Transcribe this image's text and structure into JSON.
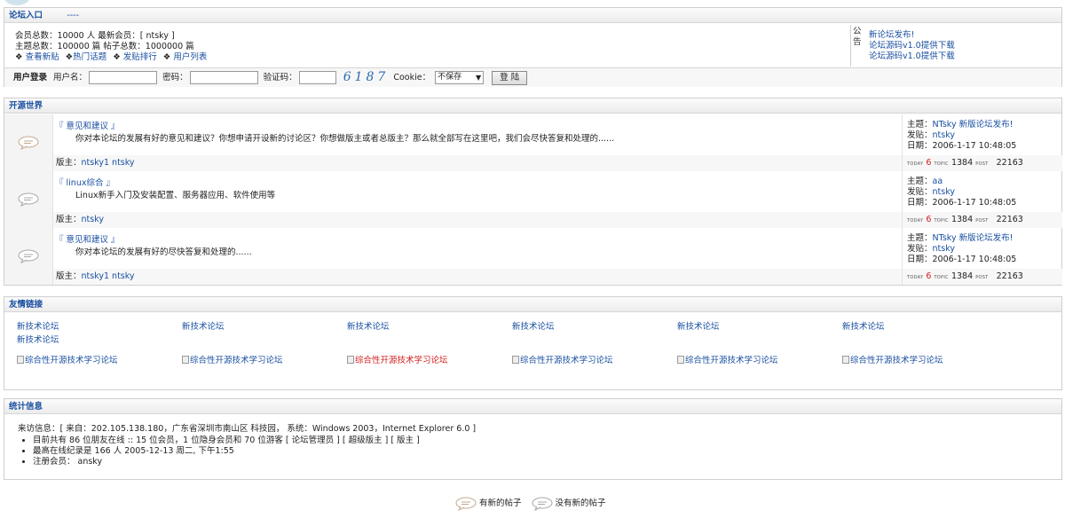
{
  "entry": {
    "title": "论坛入口",
    "dash": "----",
    "stats_line1": "会员总数：10000 人  最新会员：[ ntsky ]",
    "stats_line2": "主题总数：100000 篇  帖子总数：1000000 篇",
    "quick_links": [
      "查看新贴",
      "热门话题",
      "发贴排行",
      "用户列表"
    ],
    "notice_label": "公告",
    "notices": [
      "新论坛发布!",
      "论坛源码v1.0提供下载",
      "论坛源码v1.0提供下载"
    ]
  },
  "login": {
    "title": "用户登录",
    "username_label": "用户名：",
    "password_label": "密码：",
    "captcha_label": "验证码：",
    "captcha_code": "6187",
    "cookie_label": "Cookie：",
    "cookie_value": "不保存",
    "submit": "登 陆"
  },
  "forums": {
    "title": "开源世界",
    "items": [
      {
        "name": "『 意见和建议 』",
        "desc": "你对本论坛的发展有好的意见和建议？你想申请开设新的讨论区？你想做版主或者总版主？那么就全部写在这里吧，我们会尽快答复和处理的......",
        "mod_label": "版主：",
        "mods": "ntsky1 ntsky",
        "topic_label": "主题：",
        "topic": "NTsky 新版论坛发布!",
        "author_label": "发贴：",
        "author": "ntsky",
        "date": "日期：2006-1-17 10:48:05",
        "today_tag": "TODAY",
        "today": "6",
        "topic_tag": "TOPIC",
        "topics": "1384",
        "post_tag": "POST",
        "posts": "22163"
      },
      {
        "name": "『 linux综合 』",
        "desc": "Linux新手入门及安装配置、服务器应用、软件使用等",
        "mod_label": "版主：",
        "mods": "ntsky",
        "topic_label": "主题：",
        "topic": "aa",
        "author_label": "发贴：",
        "author": "ntsky",
        "date": "日期：2006-1-17 10:48:05",
        "today_tag": "TODAY",
        "today": "6",
        "topic_tag": "TOPIC",
        "topics": "1384",
        "post_tag": "POST",
        "posts": "22163"
      },
      {
        "name": "『 意见和建议 』",
        "desc": "你对本论坛的发展有好的尽快答复和处理的......",
        "mod_label": "版主：",
        "mods": "ntsky1 ntsky",
        "topic_label": "主题：",
        "topic": "NTsky 新版论坛发布!",
        "author_label": "发贴：",
        "author": "ntsky",
        "date": "日期：2006-1-17 10:48:05",
        "today_tag": "TODAY",
        "today": "6",
        "topic_tag": "TOPIC",
        "topics": "1384",
        "post_tag": "POST",
        "posts": "22163"
      }
    ]
  },
  "friend_links": {
    "title": "友情链接",
    "text_links": [
      "新技术论坛",
      "新技术论坛",
      "新技术论坛",
      "新技术论坛",
      "新技术论坛",
      "新技术论坛",
      "新技术论坛"
    ],
    "image_links": [
      "综合性开源技术学习论坛",
      "综合性开源技术学习论坛",
      "综合性开源技术学习论坛",
      "综合性开源技术学习论坛",
      "综合性开源技术学习论坛",
      "综合性开源技术学习论坛"
    ],
    "highlight_color": "#d21c1c"
  },
  "stats": {
    "title": "统计信息",
    "visitor": "来访信息：[ 来自：202.105.138.180，广东省深圳市南山区 科技园， 系统：Windows 2003，Internet Explorer 6.0 ]",
    "online": "目前共有 86 位朋友在线 :: 15 位会员，1 位隐身会员和 70 位游客 [ 论坛管理员 ] [ 超级版主 ] [ 版主 ]",
    "record": "最高在线纪录是 166 人 2005-12-13 周二, 下午1:55",
    "members": "注册会员： ansky"
  },
  "legend": {
    "new_posts": "有新的帖子",
    "no_new_posts": "没有新的帖子"
  },
  "colors": {
    "link": "#1a4fa0",
    "accent_red": "#d21c1c",
    "header_bg": "#ececec"
  }
}
